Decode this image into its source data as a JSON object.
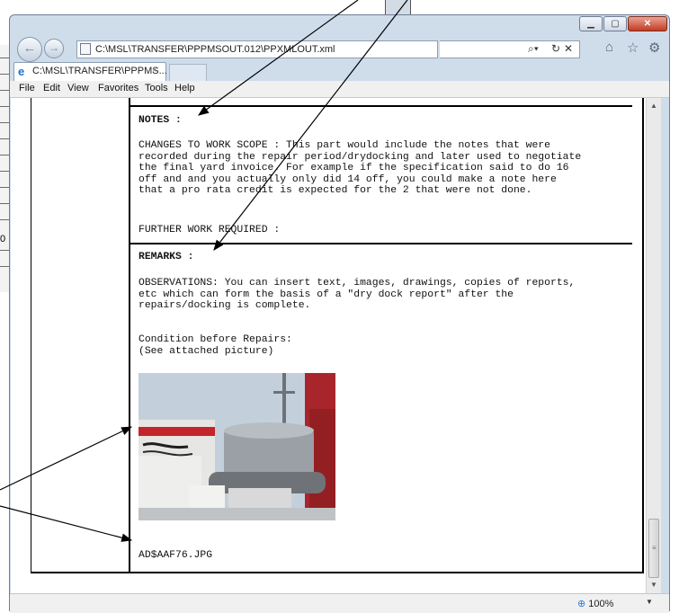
{
  "browser": {
    "address_url": "C:\\MSL\\TRANSFER\\PPPMSOUT.012\\PPXMLOUT.xml",
    "tab_title": "C:\\MSL\\TRANSFER\\PPPMS...",
    "tab_close": "×",
    "search_icon": "magnifier-icon",
    "menu": {
      "file": "File",
      "edit": "Edit",
      "view": "View",
      "favorites": "Favorites",
      "tools": "Tools",
      "help": "Help"
    },
    "zoom": "100%",
    "left_window_fragment_text": "0"
  },
  "document": {
    "notes_heading": "NOTES :",
    "changes_scope_text": "CHANGES TO WORK SCOPE : This part would include the notes that were\nrecorded during the repair period/drydocking and later used to negotiate\nthe final yard invoice. For example if the specification said to do 16\noff and and you actually only did 14 off, you could make a note here\nthat a pro rata credit is expected for the 2 that were not done.",
    "further_work": "FURTHER WORK REQUIRED :",
    "remarks_heading": "REMARKS :",
    "observations_text": "OBSERVATIONS: You can insert text, images, drawings, copies of reports,\netc which can form the basis of a \"dry dock report\" after the\nrepairs/docking is complete.",
    "condition_text": "Condition before Repairs:\n(See attached picture)",
    "image_filename": "AD$AAF76.JPG"
  },
  "colors": {
    "window_frame": "#cfdcea",
    "close_button": "#c33b22",
    "annotation_arrow": "#000000"
  }
}
